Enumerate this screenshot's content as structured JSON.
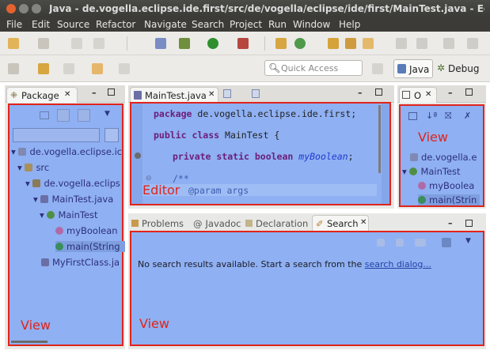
{
  "window": {
    "title": "Java - de.vogella.eclipse.ide.first/src/de/vogella/eclipse/ide/first/MainTest.java - Eclipse - /h"
  },
  "menu": [
    "File",
    "Edit",
    "Source",
    "Refactor",
    "Navigate",
    "Search",
    "Project",
    "Run",
    "Window",
    "Help"
  ],
  "toolbar": {
    "quick_access_placeholder": "Quick Access",
    "perspective_java": "Java",
    "perspective_debug": "Debug"
  },
  "package_view": {
    "tab_label": "Package",
    "tree": [
      {
        "label": "de.vogella.eclipse.ic"
      },
      {
        "label": "src"
      },
      {
        "label": "de.vogella.eclips"
      },
      {
        "label": "MainTest.java"
      },
      {
        "label": "MainTest"
      },
      {
        "label": "myBoolean"
      },
      {
        "label": "main(String"
      },
      {
        "label": "MyFirstClass.ja"
      }
    ],
    "overlay_label": "View"
  },
  "editor": {
    "tab_label": "MainTest.java",
    "lines": {
      "pkg_kw": "package",
      "pkg_rest": " de.vogella.eclipse.ide.first;",
      "class_kw": "public class",
      "class_rest": " MainTest {",
      "field_kw": "private static boolean",
      "field_name": "myBoolean",
      "field_end": ";",
      "doc_open": "/**",
      "doc_param": "@param args"
    },
    "overlay_label": "Editor"
  },
  "outline_view": {
    "tab_label": "O",
    "tree": [
      {
        "label": "de.vogella.e"
      },
      {
        "label": "MainTest"
      },
      {
        "label": "myBoolea"
      },
      {
        "label": "main(Strin"
      }
    ],
    "overlay_label": "View"
  },
  "bottom_view": {
    "tabs": [
      "Problems",
      "Javadoc",
      "Declaration",
      "Search"
    ],
    "message_prefix": "No search results available. Start a search from the ",
    "message_link": "search dialog...",
    "overlay_label": "View"
  },
  "colors": {
    "highlight_fill": "#8fb0f2",
    "highlight_border": "#e0241b"
  }
}
